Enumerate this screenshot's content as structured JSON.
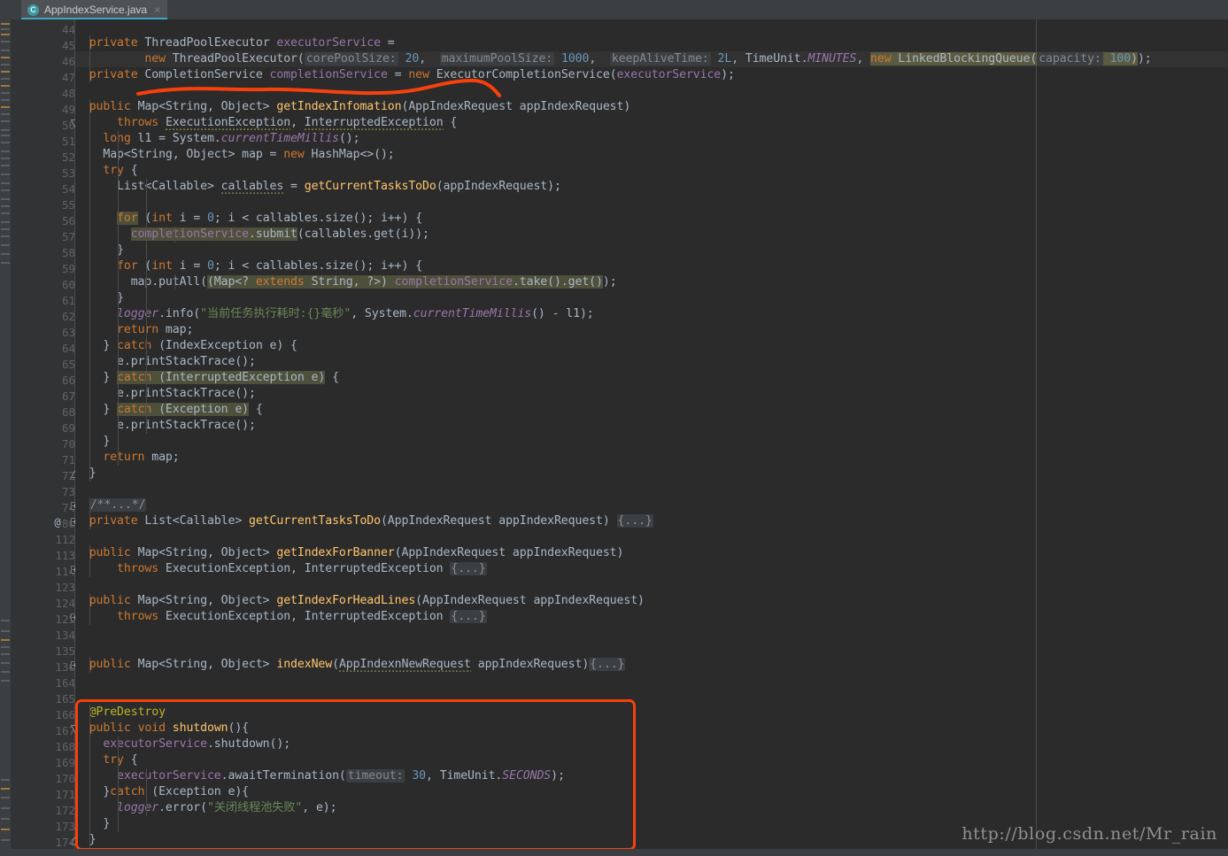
{
  "window": {
    "app": "IntelliJ IDEA Editor",
    "theme_background": "#2b2b2b",
    "gutter_background": "#313335",
    "accent": "#3ba7c4",
    "annotation_color": "#f8400c"
  },
  "tab": {
    "label": "AppIndexService.java",
    "icon": "java-class-icon",
    "icon_letter": "C",
    "close_label": "×"
  },
  "watermark": "http://blog.csdn.net/Mr_rain",
  "gutter": {
    "line_numbers": [
      "44",
      "45",
      "46",
      "47",
      "48",
      "49",
      "50",
      "51",
      "52",
      "53",
      "54",
      "55",
      "56",
      "57",
      "58",
      "59",
      "60",
      "61",
      "62",
      "63",
      "64",
      "65",
      "66",
      "67",
      "68",
      "69",
      "70",
      "71",
      "72",
      "73",
      "74",
      "80",
      "112",
      "113",
      "114",
      "123",
      "124",
      "125",
      "134",
      "135",
      "136",
      "164",
      "165",
      "166",
      "167",
      "168",
      "169",
      "170",
      "171",
      "172",
      "173",
      "174"
    ],
    "annotation_marker": "@",
    "annotation_marker_line": "80"
  },
  "code": {
    "lines": [
      {
        "n": "44",
        "text": ""
      },
      {
        "n": "45",
        "text": "private ThreadPoolExecutor executorService ="
      },
      {
        "n": "46",
        "text": "        new ThreadPoolExecutor( corePoolSize: 20,  maximumPoolSize: 1000,  keepAliveTime: 2L, TimeUnit.MINUTES, new LinkedBlockingQueue( capacity: 100));"
      },
      {
        "n": "47",
        "text": "private CompletionService completionService = new ExecutorCompletionService(executorService);"
      },
      {
        "n": "48",
        "text": ""
      },
      {
        "n": "49",
        "text": "public Map<String, Object> getIndexInfomation(AppIndexRequest appIndexRequest)"
      },
      {
        "n": "50",
        "text": "    throws ExecutionException, InterruptedException {"
      },
      {
        "n": "51",
        "text": "  long l1 = System.currentTimeMillis();"
      },
      {
        "n": "52",
        "text": "  Map<String, Object> map = new HashMap<>();"
      },
      {
        "n": "53",
        "text": "  try {"
      },
      {
        "n": "54",
        "text": "    List<Callable> callables = getCurrentTasksToDo(appIndexRequest);"
      },
      {
        "n": "55",
        "text": ""
      },
      {
        "n": "56",
        "text": "    for (int i = 0; i < callables.size(); i++) {"
      },
      {
        "n": "57",
        "text": "      completionService.submit(callables.get(i));"
      },
      {
        "n": "58",
        "text": "    }"
      },
      {
        "n": "59",
        "text": "    for (int i = 0; i < callables.size(); i++) {"
      },
      {
        "n": "60",
        "text": "      map.putAll((Map<? extends String, ?>) completionService.take().get());"
      },
      {
        "n": "61",
        "text": "    }"
      },
      {
        "n": "62",
        "text": "    logger.info(\"当前任务执行耗时:{}毫秒\", System.currentTimeMillis() - l1);"
      },
      {
        "n": "63",
        "text": "    return map;"
      },
      {
        "n": "64",
        "text": "  } catch (IndexException e) {"
      },
      {
        "n": "65",
        "text": "    e.printStackTrace();"
      },
      {
        "n": "66",
        "text": "  } catch (InterruptedException e) {"
      },
      {
        "n": "67",
        "text": "    e.printStackTrace();"
      },
      {
        "n": "68",
        "text": "  } catch (Exception e) {"
      },
      {
        "n": "69",
        "text": "    e.printStackTrace();"
      },
      {
        "n": "70",
        "text": "  }"
      },
      {
        "n": "71",
        "text": "  return map;"
      },
      {
        "n": "72",
        "text": "}"
      },
      {
        "n": "73",
        "text": ""
      },
      {
        "n": "74",
        "text": "/**...*/"
      },
      {
        "n": "80",
        "text": "private List<Callable> getCurrentTasksToDo(AppIndexRequest appIndexRequest) {...}"
      },
      {
        "n": "112",
        "text": ""
      },
      {
        "n": "113",
        "text": "public Map<String, Object> getIndexForBanner(AppIndexRequest appIndexRequest)"
      },
      {
        "n": "114",
        "text": "    throws ExecutionException, InterruptedException {...}"
      },
      {
        "n": "123",
        "text": ""
      },
      {
        "n": "124",
        "text": "public Map<String, Object> getIndexForHeadLines(AppIndexRequest appIndexRequest)"
      },
      {
        "n": "125",
        "text": "    throws ExecutionException, InterruptedException {...}"
      },
      {
        "n": "134",
        "text": ""
      },
      {
        "n": "135",
        "text": ""
      },
      {
        "n": "136",
        "text": "public Map<String, Object> indexNew(AppIndexnNewRequest appIndexRequest){...}"
      },
      {
        "n": "164",
        "text": ""
      },
      {
        "n": "165",
        "text": ""
      },
      {
        "n": "166",
        "text": "@PreDestroy"
      },
      {
        "n": "167",
        "text": "public void shutdown(){"
      },
      {
        "n": "168",
        "text": "  executorService.shutdown();"
      },
      {
        "n": "169",
        "text": "  try {"
      },
      {
        "n": "170",
        "text": "    executorService.awaitTermination( timeout: 30, TimeUnit.SECONDS);"
      },
      {
        "n": "171",
        "text": "  }catch (Exception e){"
      },
      {
        "n": "172",
        "text": "    logger.error(\"关闭线程池失败\", e);"
      },
      {
        "n": "173",
        "text": "  }"
      },
      {
        "n": "174",
        "text": "}"
      }
    ],
    "inlay_hints": [
      "corePoolSize:",
      "maximumPoolSize:",
      "keepAliveTime:",
      "capacity:",
      "timeout:"
    ],
    "folded_placeholders": [
      "/**...*/",
      "{...}"
    ],
    "strings": [
      "\"当前任务执行耗时:{}毫秒\"",
      "\"关闭线程池失败\""
    ],
    "numbers": [
      "20",
      "1000",
      "2L",
      "100",
      "0",
      "30"
    ],
    "annotations_in_code": [
      "@PreDestroy"
    ]
  }
}
